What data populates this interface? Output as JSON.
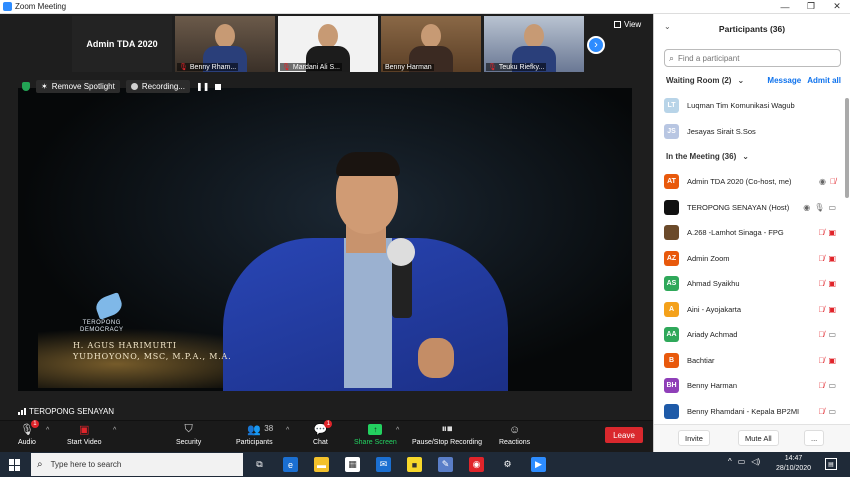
{
  "window": {
    "title": "Zoom Meeting",
    "controls": [
      "—",
      "❐",
      "✕"
    ]
  },
  "gallery": {
    "tiles": [
      {
        "label": "Admin TDA 2020",
        "muted": false,
        "type": "text"
      },
      {
        "label": "Benny Rham...",
        "muted": true,
        "type": "room"
      },
      {
        "label": "Mardani Ali S...",
        "muted": true,
        "type": "white"
      },
      {
        "label": "Benny Harman",
        "muted": false,
        "type": "wood"
      },
      {
        "label": "Teuku Riefky...",
        "muted": true,
        "type": "blue"
      }
    ],
    "next_icon": "chevron-right-icon",
    "view_label": "View"
  },
  "spotlight": {
    "remove_label": "Remove Spotlight",
    "recording_label": "Recording..."
  },
  "video": {
    "logo_text_1": "TEROPONG",
    "logo_text_2": "DEMOCRACY",
    "caption_line1": "H. AGUS HARIMURTI",
    "caption_line2": "YUDHOYONO, MSC, M.P.A., M.A."
  },
  "active_speaker": "TEROPONG SENAYAN",
  "toolbar": {
    "audio": "Audio",
    "audio_badge": "1",
    "start_video": "Start Video",
    "security": "Security",
    "participants": "Participants",
    "participants_count": "38",
    "chat": "Chat",
    "chat_badge": "1",
    "share": "Share Screen",
    "recording": "Pause/Stop Recording",
    "reactions": "Reactions",
    "end": "Leave"
  },
  "panel": {
    "title": "Participants (36)",
    "search_placeholder": "Find a participant",
    "waiting_room": "Waiting Room (2)",
    "message": "Message",
    "admit_all": "Admit all",
    "waiting": [
      {
        "initials": "LT",
        "name": "Luqman Tim Komunikasi Wagub",
        "color": "#b8d4e8"
      },
      {
        "initials": "JS",
        "name": "Jesayas Sirait S.Sos",
        "color": "#b8c6e2"
      }
    ],
    "in_meeting": "In the Meeting (36)",
    "participants": [
      {
        "initials": "AT",
        "name": "Admin TDA 2020 (Co-host, me)",
        "color": "#e8590c",
        "icons": [
          "rec",
          "mic-off"
        ]
      },
      {
        "initials": "",
        "name": "TEROPONG SENAYAN (Host)",
        "color": "#111111",
        "icons": [
          "rec",
          "mic-on",
          "cam-on"
        ]
      },
      {
        "initials": "",
        "name": "A.268 -Lamhot Sinaga - FPG",
        "color": "#6b4a2a",
        "icons": [
          "mic-off",
          "cam-off"
        ]
      },
      {
        "initials": "AZ",
        "name": "Admin Zoom",
        "color": "#e8590c",
        "icons": [
          "mic-off",
          "cam-off"
        ]
      },
      {
        "initials": "AS",
        "name": "Ahmad Syaikhu",
        "color": "#2fa85a",
        "icons": [
          "mic-off",
          "cam-off"
        ]
      },
      {
        "initials": "A",
        "name": "Aini - Ayojakarta",
        "color": "#f4a11a",
        "icons": [
          "mic-off",
          "cam-off"
        ]
      },
      {
        "initials": "AA",
        "name": "Ariady Achmad",
        "color": "#2fa85a",
        "icons": [
          "mic-off",
          "cam-on"
        ]
      },
      {
        "initials": "B",
        "name": "Bachtiar",
        "color": "#e8590c",
        "icons": [
          "mic-off",
          "cam-off"
        ]
      },
      {
        "initials": "BH",
        "name": "Benny Harman",
        "color": "#8f3fb8",
        "icons": [
          "mic-off",
          "cam-on"
        ]
      },
      {
        "initials": "",
        "name": "Benny Rhamdani - Kepala BP2MI",
        "color": "#1e5aa8",
        "icons": [
          "mic-off",
          "cam-on"
        ]
      }
    ],
    "invite": "Invite",
    "mute_all": "Mute All",
    "more": "..."
  },
  "taskbar": {
    "search_placeholder": "Type here to search",
    "time": "14:47",
    "date": "28/10/2020",
    "apps": [
      {
        "icon": "task-view-icon",
        "color": "transparent",
        "glyph": "⧉"
      },
      {
        "icon": "edge-icon",
        "color": "#1b6fd1",
        "glyph": "e"
      },
      {
        "icon": "file-explorer-icon",
        "color": "#f3c12b",
        "glyph": "▬"
      },
      {
        "icon": "store-icon",
        "color": "#ffffff",
        "glyph": "▦"
      },
      {
        "icon": "mail-icon",
        "color": "#1b6fd1",
        "glyph": "✉"
      },
      {
        "icon": "sticky-notes-icon",
        "color": "#f7d82b",
        "glyph": "■"
      },
      {
        "icon": "photo-app-icon",
        "color": "#5a7ec8",
        "glyph": "✎"
      },
      {
        "icon": "chrome-icon",
        "color": "#e0242a",
        "glyph": "◉"
      },
      {
        "icon": "settings-icon",
        "color": "transparent",
        "glyph": "⚙"
      },
      {
        "icon": "zoom-icon",
        "color": "#2d8cff",
        "glyph": "▶"
      }
    ]
  }
}
